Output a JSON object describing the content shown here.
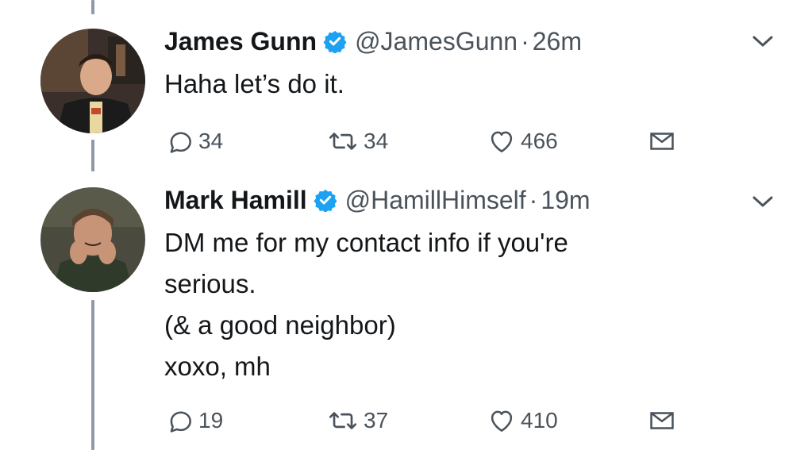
{
  "tweets": [
    {
      "display_name": "James Gunn",
      "verified": true,
      "handle": "@JamesGunn",
      "separator": "·",
      "time": "26m",
      "text_lines": [
        "Haha let’s do it."
      ],
      "reply_count": "34",
      "retweet_count": "34",
      "like_count": "466"
    },
    {
      "display_name": "Mark Hamill",
      "verified": true,
      "handle": "@HamillHimself",
      "separator": "·",
      "time": "19m",
      "text_lines": [
        "DM me for my contact info if you're",
        "serious.",
        "(& a good neighbor)",
        "xoxo, mh"
      ],
      "reply_count": "19",
      "retweet_count": "37",
      "like_count": "410"
    }
  ],
  "icons": {
    "verified": "verified-badge-icon",
    "caret": "chevron-down-icon",
    "reply": "reply-icon",
    "retweet": "retweet-icon",
    "like": "heart-icon",
    "dm": "envelope-icon"
  },
  "colors": {
    "verified_blue": "#1da1f2",
    "icon_gray": "#4a535b",
    "text": "#14171a",
    "thread_line": "#8f9aa6"
  }
}
